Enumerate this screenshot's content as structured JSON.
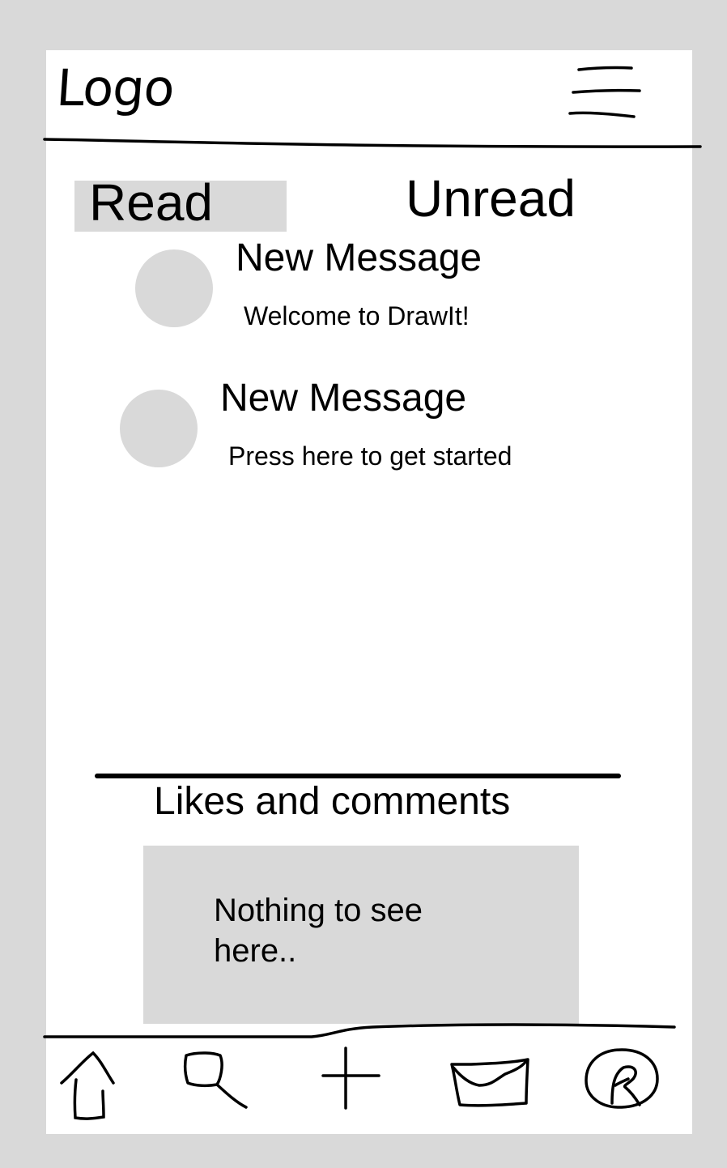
{
  "header": {
    "logo_text": "Logo",
    "menu_icon": "hamburger-menu-icon"
  },
  "tabs": [
    {
      "label": "Read",
      "selected": true
    },
    {
      "label": "Unread",
      "selected": false
    }
  ],
  "messages": [
    {
      "title": "New Message",
      "body": "Welcome to DrawIt!"
    },
    {
      "title": "New Message",
      "body": "Press here to get started"
    }
  ],
  "likes_section": {
    "title": "Likes and comments",
    "empty_text": "Nothing to see here.."
  },
  "bottom_nav": [
    {
      "icon": "home-icon"
    },
    {
      "icon": "search-icon"
    },
    {
      "icon": "plus-icon"
    },
    {
      "icon": "inbox-icon"
    },
    {
      "icon": "profile-icon"
    }
  ],
  "colors": {
    "background": "#d9d9d9",
    "surface": "#ffffff",
    "placeholder": "#d9d9d9",
    "ink": "#000000"
  }
}
